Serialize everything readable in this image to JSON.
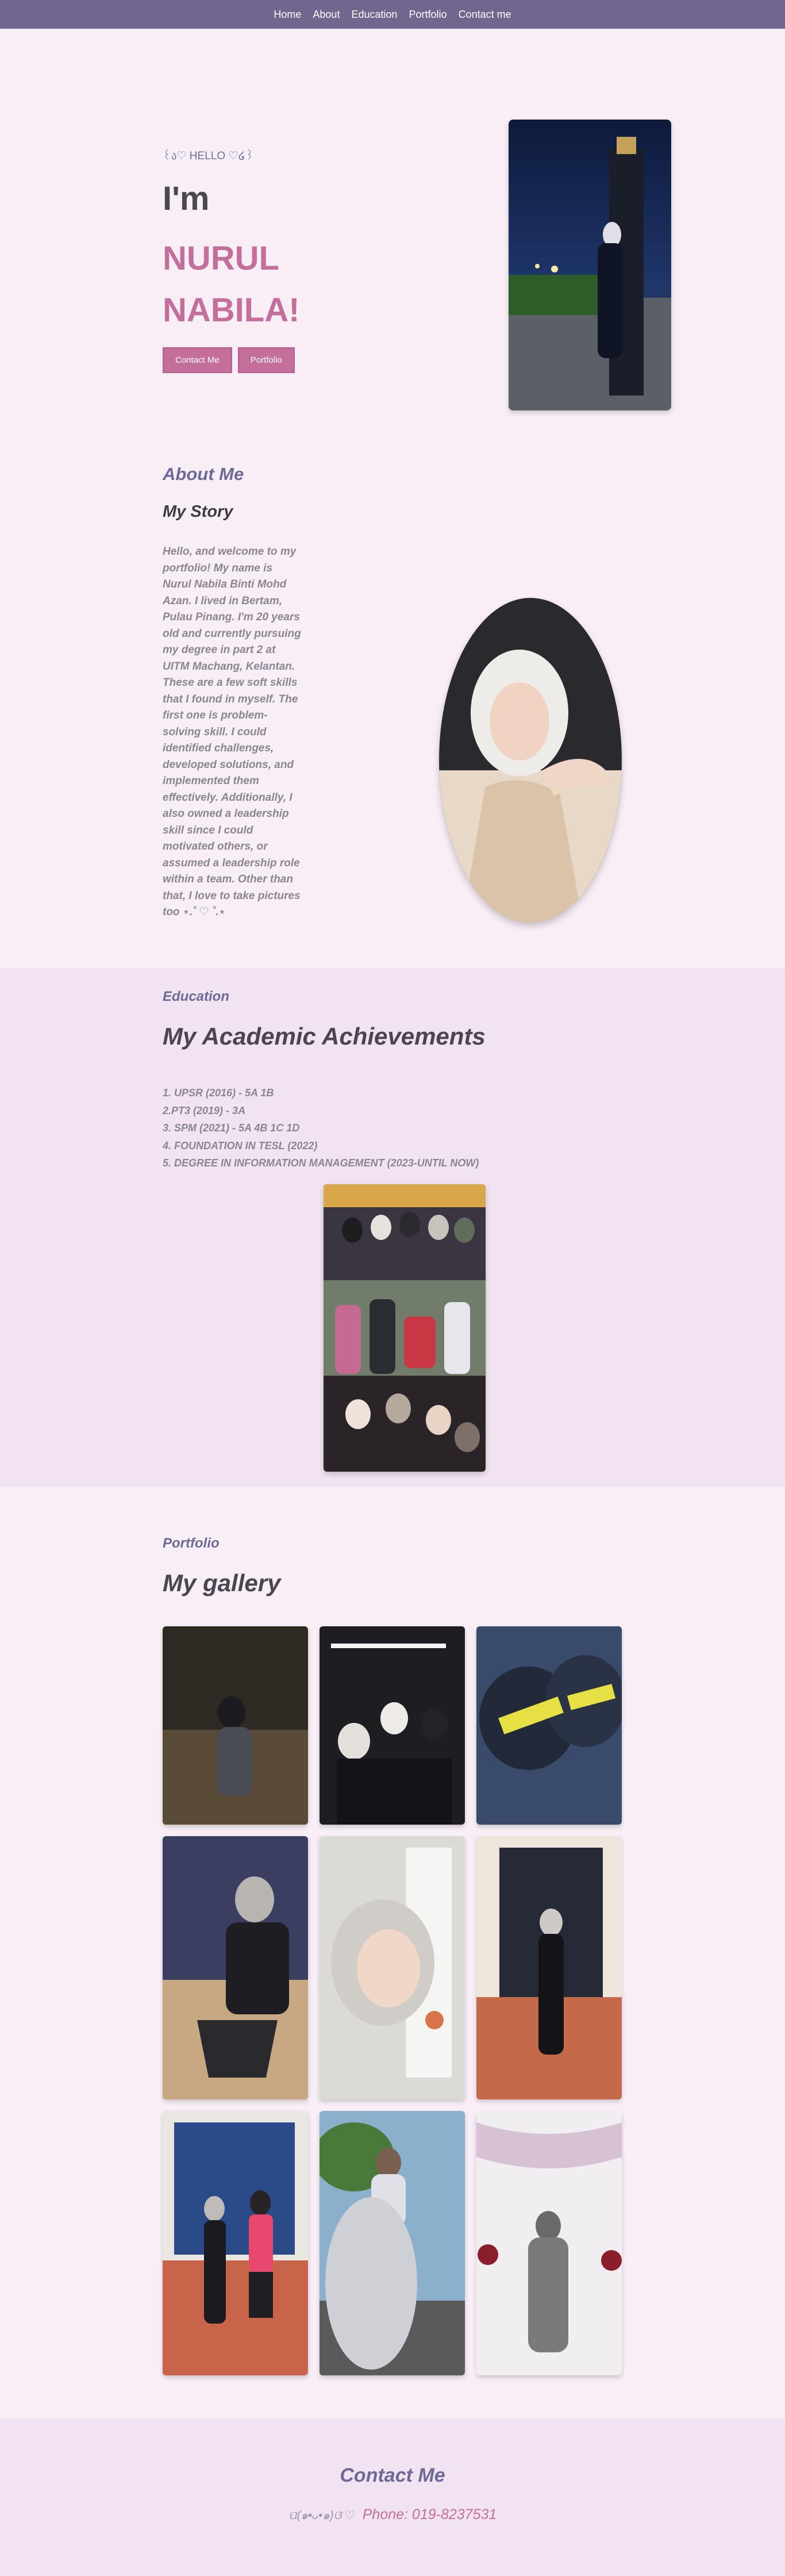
{
  "nav": {
    "items": [
      "Home",
      "About",
      "Education",
      "Portfolio",
      "Contact me"
    ]
  },
  "hero": {
    "hello": "꒰ა♡ HELLO ♡໒꒱",
    "im": "I'm",
    "name": "NURUL NABILA!",
    "contact_button": "Contact Me",
    "portfolio_button": "Portfolio",
    "photo_icon": "portrait-photo"
  },
  "about": {
    "label": "About Me",
    "subtitle": "My Story",
    "text": "Hello, and welcome to my portfolio! My name is Nurul Nabila Binti Mohd Azan. I lived in Bertam, Pulau Pinang. I'm 20 years old and currently pursuing my degree in part 2 at UITM Machang, Kelantan. These are a few soft skills that I found in myself. The first one is problem-solving skill. I could identified challenges, developed solutions, and implemented them effectively. Additionally, I also owned a leadership skill since I could motivated others, or assumed a leadership role within a team. Other than that, I love to take pictures too ⋆.˚ ♡ ˚.⋆",
    "photo_icon": "selfie-photo"
  },
  "education": {
    "label": "Education",
    "title": "My Academic Achievements",
    "items": [
      "1. UPSR (2016) - 5A 1B",
      "2.PT3 (2019) - 3A",
      "3. SPM (2021) - 5A 4B 1C 1D",
      "4. FOUNDATION IN TESL (2022)",
      "5. DEGREE IN INFORMATION MANAGEMENT (2023-UNTIL NOW)"
    ],
    "photo_icon": "friends-collage-photo"
  },
  "portfolio": {
    "label": "Portfolio",
    "title": "My gallery",
    "images": [
      "night-portrait",
      "event-selfie",
      "banner-photo",
      "seated-portrait",
      "mirror-selfie",
      "door-portrait",
      "couple-door-photo",
      "playground-photo",
      "graduation-photo"
    ]
  },
  "contact": {
    "title": "Contact Me",
    "decoration": "ପ(๑•ᴗ•๑)ଓ ♡",
    "phone": "Phone: 019-8237531"
  },
  "colors": {
    "nav_bg": "#72668f",
    "page_bg": "#f8eff6",
    "accent_pink": "#c46e9c",
    "section_bg": "#f1e4f0",
    "heading_purple": "#6d6a97"
  }
}
